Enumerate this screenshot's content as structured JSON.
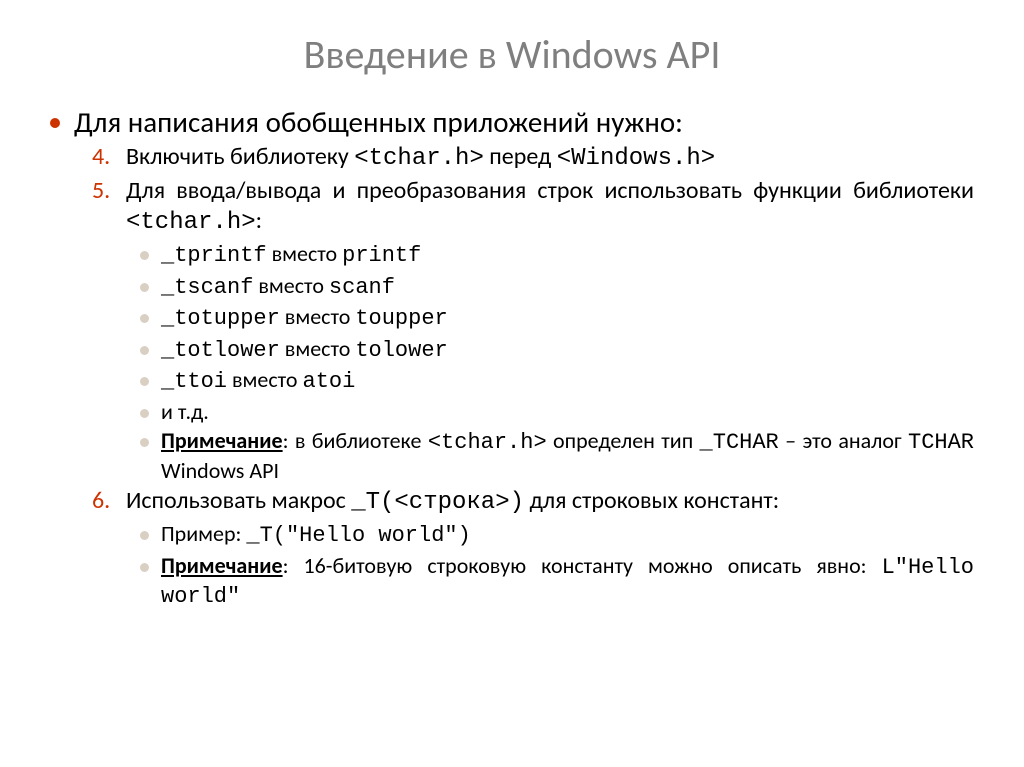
{
  "title": "Введение в Windows API",
  "main_bullet": "Для написания обобщенных приложений нужно:",
  "items": {
    "n4": {
      "num": "4.",
      "pre": "Включить библиотеку ",
      "code1": "<tchar.h>",
      "mid": " перед ",
      "code2": "<Windows.h>"
    },
    "n5": {
      "num": "5.",
      "line1": "Для ввода/вывода и преобразования строк использовать функции библиотеки ",
      "code": "<tchar.h>",
      "after": ":"
    },
    "sub": {
      "a": {
        "code": "_tprintf",
        "mid": " вместо ",
        "code2": "printf"
      },
      "b": {
        "code": "_tscanf",
        "mid": " вместо ",
        "code2": "scanf"
      },
      "c": {
        "code": "_totupper",
        "mid": " вместо ",
        "code2": "toupper"
      },
      "d": {
        "code": "_totlower",
        "mid": " вместо ",
        "code2": "tolower"
      },
      "e": {
        "code": "_ttoi",
        "mid": " вместо ",
        "code2": "atoi"
      },
      "f": "и т.д.",
      "note": {
        "label": "Примечание",
        "p1": ": в библиотеке ",
        "c1": "<tchar.h>",
        "p2": " определен тип ",
        "c2": "_TCHAR",
        "p3": " – это аналог ",
        "c3": "TCHAR",
        "p4": " Windows API"
      }
    },
    "n6": {
      "num": "6.",
      "pre": "Использовать макрос ",
      "code": "_T(<строка>)",
      "post": " для строковых констант:"
    },
    "sub6": {
      "ex": {
        "label": "Пример: ",
        "code": "_T(\"Hello world\")"
      },
      "note": {
        "label": "Примечание",
        "p1": ": 16-битовую строковую константу можно описать явно: ",
        "code": "L\"Hello world\""
      }
    }
  }
}
